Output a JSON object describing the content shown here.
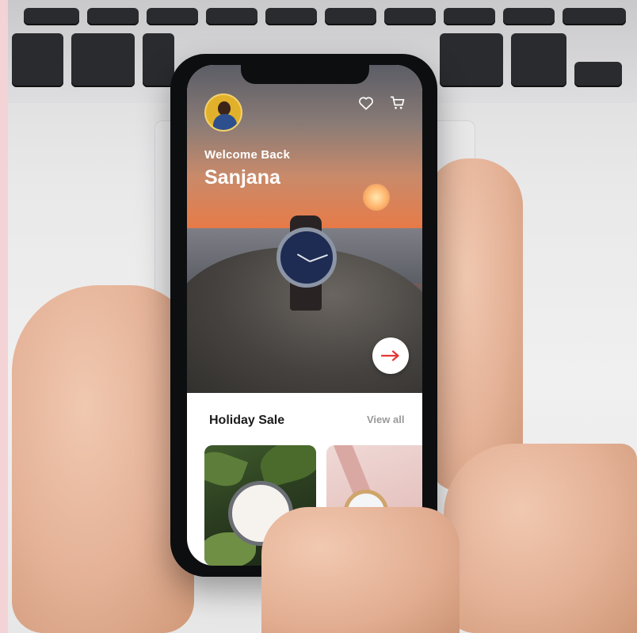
{
  "app": {
    "greeting": "Welcome Back",
    "user_name": "Sanjana"
  },
  "header": {
    "icons": [
      "heart-icon",
      "cart-icon"
    ]
  },
  "hero": {
    "cta_icon": "arrow-right-icon"
  },
  "section": {
    "title": "Holiday Sale",
    "view_all_label": "View all"
  },
  "colors": {
    "accent": "#e53935",
    "text_dark": "#1b1b1b",
    "text_muted": "#9a9a9a",
    "avatar_bg": "#e2b12c"
  }
}
